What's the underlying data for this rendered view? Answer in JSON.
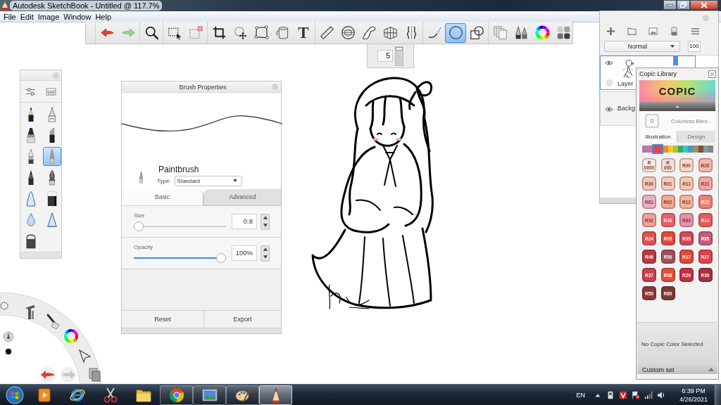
{
  "window": {
    "title": "Autodesk SketchBook - Untitled @ 117.7%"
  },
  "menu": [
    {
      "label": "File"
    },
    {
      "label": "Edit"
    },
    {
      "label": "Image"
    },
    {
      "label": "Window"
    },
    {
      "label": "Help"
    }
  ],
  "toolbar": {
    "groups": [
      [
        {
          "kind": "undo",
          "selected": false
        },
        {
          "kind": "redo",
          "selected": false
        }
      ],
      [
        {
          "kind": "zoom",
          "selected": false
        }
      ],
      [
        {
          "kind": "select",
          "selected": false
        },
        {
          "kind": "deselect",
          "selected": false
        }
      ],
      [
        {
          "kind": "crop",
          "selected": false
        },
        {
          "kind": "move",
          "selected": false
        },
        {
          "kind": "distort",
          "selected": false
        },
        {
          "kind": "fill",
          "selected": false
        },
        {
          "kind": "text",
          "label": "T",
          "selected": false
        }
      ],
      [
        {
          "kind": "ruler",
          "selected": false
        },
        {
          "kind": "ellipse_guide",
          "selected": false
        },
        {
          "kind": "curve",
          "selected": false
        },
        {
          "kind": "perspective",
          "selected": false
        },
        {
          "kind": "symmetry",
          "selected": false
        }
      ],
      [
        {
          "kind": "stroke",
          "selected": false
        },
        {
          "kind": "ellipse",
          "selected": true
        },
        {
          "kind": "shapes",
          "selected": false
        }
      ],
      [
        {
          "kind": "copy",
          "selected": false
        },
        {
          "kind": "brushes",
          "selected": false
        },
        {
          "kind": "color",
          "selected": false
        },
        {
          "kind": "copic",
          "selected": false
        }
      ]
    ]
  },
  "brush_size": {
    "value": "5",
    "level": 1
  },
  "brush_palette": {
    "items": [
      {
        "kind": "pencil",
        "selected": false
      },
      {
        "kind": "inkpen",
        "selected": false
      },
      {
        "kind": "marker",
        "selected": false
      },
      {
        "kind": "chisel",
        "selected": false
      },
      {
        "kind": "ballpoint",
        "selected": false
      },
      {
        "kind": "brush",
        "selected": true
      },
      {
        "kind": "felttip",
        "selected": false
      },
      {
        "kind": "nib",
        "selected": false
      },
      {
        "kind": "cone",
        "selected": false
      },
      {
        "kind": "block",
        "selected": false
      },
      {
        "kind": "drop",
        "selected": false
      },
      {
        "kind": "triangle",
        "selected": false
      },
      {
        "kind": "dome",
        "selected": false
      }
    ]
  },
  "brush_properties": {
    "title": "Brush Properties",
    "name": "Paintbrush",
    "type_label": "Type:",
    "type_value": "Standard",
    "tabs": [
      {
        "label": "Basic",
        "selected": true
      },
      {
        "label": "Advanced",
        "selected": false
      }
    ],
    "sliders": [
      {
        "label": "Size",
        "value": "0.8",
        "level": 0
      },
      {
        "label": "Opacity",
        "value": "100%",
        "level": 1
      }
    ],
    "buttons": [
      {
        "label": "Reset"
      },
      {
        "label": "Export"
      }
    ]
  },
  "layers": {
    "blend_mode": "Normal",
    "opacity": "100",
    "items": [
      {
        "kind": "paint",
        "name": "Layer",
        "visible": true,
        "selected": true
      },
      {
        "kind": "background",
        "name": "Backg",
        "visible": true,
        "selected": false
      }
    ]
  },
  "copic": {
    "title": "Copic Library",
    "logo": "COPIC",
    "blender": {
      "code": "0",
      "name": "Colorless Blen..."
    },
    "tabs": [
      {
        "label": "Illustration",
        "selected": true
      },
      {
        "label": "Design",
        "selected": false
      }
    ],
    "families": [
      {
        "color": "#a47cb8",
        "selected": false
      },
      {
        "color": "#e26a92",
        "selected": false
      },
      {
        "color": "#e04452",
        "selected": true
      },
      {
        "color": "#f08a30",
        "selected": false
      },
      {
        "color": "#f4c832",
        "selected": false
      },
      {
        "color": "#a8c040",
        "selected": false
      },
      {
        "color": "#3fa862",
        "selected": false
      },
      {
        "color": "#3ec4c4",
        "selected": false
      },
      {
        "color": "#4a98c8",
        "selected": false
      },
      {
        "color": "#a88a64",
        "selected": false
      },
      {
        "color": "#7a5040",
        "selected": false
      },
      {
        "color": "#8898a8",
        "selected": false
      },
      {
        "color": "#858585",
        "selected": false
      }
    ],
    "swatches": [
      {
        "code": "R 0000",
        "color": "#f6ece6"
      },
      {
        "code": "R 000",
        "color": "#f3e0d8"
      },
      {
        "code": "R00",
        "color": "#f8d8c8"
      },
      {
        "code": "R20",
        "color": "#f6b8aa"
      },
      {
        "code": "R30",
        "color": "#f4c6b8"
      },
      {
        "code": "R01",
        "color": "#f6ccb8"
      },
      {
        "code": "R11",
        "color": "#f8c8b0"
      },
      {
        "code": "R21",
        "color": "#f4a6a0"
      },
      {
        "code": "R81",
        "color": "#eab0c6"
      },
      {
        "code": "R02",
        "color": "#f4a890"
      },
      {
        "code": "R12",
        "color": "#f6b49a"
      },
      {
        "code": "R22",
        "color": "#ee8078"
      },
      {
        "code": "R32",
        "color": "#f0a098"
      },
      {
        "code": "R43",
        "color": "#ea6070"
      },
      {
        "code": "R83",
        "color": "#e890aa"
      },
      {
        "code": "R14",
        "color": "#e85a58"
      },
      {
        "code": "R24",
        "color": "#e05050"
      },
      {
        "code": "R05",
        "color": "#e24a38"
      },
      {
        "code": "R35",
        "color": "#d84858"
      },
      {
        "code": "R85",
        "color": "#c85a7a"
      },
      {
        "code": "R46",
        "color": "#b83848"
      },
      {
        "code": "R56",
        "color": "#a05060"
      },
      {
        "code": "R17",
        "color": "#e04a38"
      },
      {
        "code": "R27",
        "color": "#e04050"
      },
      {
        "code": "R37",
        "color": "#c84050"
      },
      {
        "code": "R08",
        "color": "#e05238"
      },
      {
        "code": "R29",
        "color": "#c83040"
      },
      {
        "code": "R39",
        "color": "#a83040"
      },
      {
        "code": "R59",
        "color": "#8a3838"
      },
      {
        "code": "R89",
        "color": "#7a3a32"
      }
    ],
    "status": "No Copic Color Selected",
    "custom_set": "Custom set"
  },
  "taskbar": {
    "apps": [
      {
        "kind": "media",
        "running": false,
        "selected": false
      },
      {
        "kind": "ie",
        "running": false,
        "selected": false
      },
      {
        "kind": "snip",
        "running": false,
        "selected": false
      },
      {
        "kind": "folder",
        "running": false,
        "selected": false
      },
      {
        "kind": "chrome",
        "running": true,
        "selected": false
      },
      {
        "kind": "photos",
        "running": true,
        "selected": false
      },
      {
        "kind": "paint",
        "running": true,
        "selected": false
      },
      {
        "kind": "sketchbook",
        "running": true,
        "selected": true
      }
    ],
    "language": "EN",
    "time": "6:39 PM",
    "date": "4/26/2021"
  }
}
